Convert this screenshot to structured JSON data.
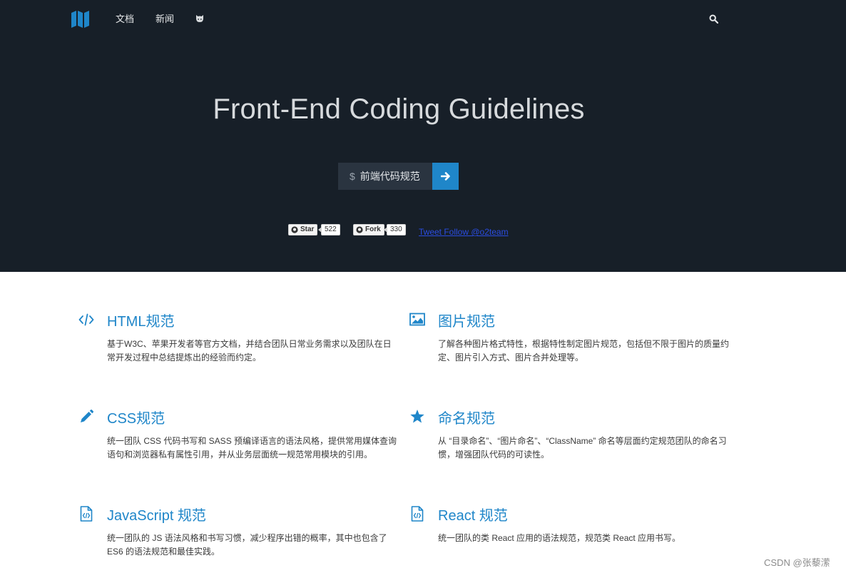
{
  "nav": {
    "docs": "文档",
    "news": "新闻",
    "github_icon": "github-icon",
    "search_icon": "search-icon",
    "logo_icon": "map-logo-icon"
  },
  "hero": {
    "title": "Front-End Coding Guidelines",
    "command_prefix": "$",
    "command_text": "前端代码规范",
    "go_icon": "arrow-right-icon",
    "star_label": "Star",
    "star_count": "522",
    "fork_label": "Fork",
    "fork_count": "330",
    "tweet_text": "Tweet Follow @o2team"
  },
  "features": [
    {
      "icon": "code-icon",
      "title": "HTML规范",
      "text": "基于W3C、苹果开发者等官方文档，并结合团队日常业务需求以及团队在日常开发过程中总结提炼出的经验而约定。"
    },
    {
      "icon": "image-icon",
      "title": "图片规范",
      "text": "了解各种图片格式特性，根据特性制定图片规范，包括但不限于图片的质量约定、图片引入方式、图片合并处理等。"
    },
    {
      "icon": "pencil-icon",
      "title": "CSS规范",
      "text": "统一团队 CSS 代码书写和 SASS 预编译语言的语法风格，提供常用媒体查询语句和浏览器私有属性引用，并从业务层面统一规范常用模块的引用。"
    },
    {
      "icon": "star-icon",
      "title": "命名规范",
      "text": "从 “目录命名”、“图片命名”、“ClassName” 命名等层面约定规范团队的命名习惯，增强团队代码的可读性。"
    },
    {
      "icon": "code-file-icon",
      "title": "JavaScript 规范",
      "text": "统一团队的 JS 语法风格和书写习惯，减少程序出错的概率，其中也包含了ES6 的语法规范和最佳实践。"
    },
    {
      "icon": "code-file-icon",
      "title": "React 规范",
      "text": "统一团队的类 React 应用的语法规范，规范类 React 应用书写。"
    }
  ],
  "colors": {
    "hero_bg": "#171f28",
    "accent": "#1f86c9"
  },
  "watermark": "CSDN @张藜潆"
}
